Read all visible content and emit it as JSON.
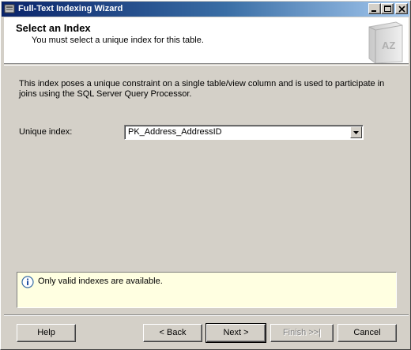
{
  "window": {
    "title": "Full-Text Indexing Wizard",
    "controls": [
      "minimize-icon",
      "maximize-icon",
      "close-icon"
    ]
  },
  "header": {
    "title": "Select an Index",
    "subtitle": "You must select a unique index for this table.",
    "art_text": "AZ"
  },
  "body": {
    "description": "This index poses a unique constraint on a single table/view column and is used to participate in joins using the SQL Server Query Processor.",
    "unique_index_label": "Unique index:",
    "unique_index_value": "PK_Address_AddressID"
  },
  "info": {
    "icon": "info-icon",
    "text": "Only valid indexes are available."
  },
  "buttons": {
    "help": "Help",
    "back": "< Back",
    "next": "Next >",
    "finish": "Finish >>|",
    "cancel": "Cancel"
  },
  "colors": {
    "titlebar_start": "#0a246a",
    "titlebar_end": "#a6caf0",
    "dialog_bg": "#d4d0c8",
    "info_bg": "#ffffe1"
  }
}
